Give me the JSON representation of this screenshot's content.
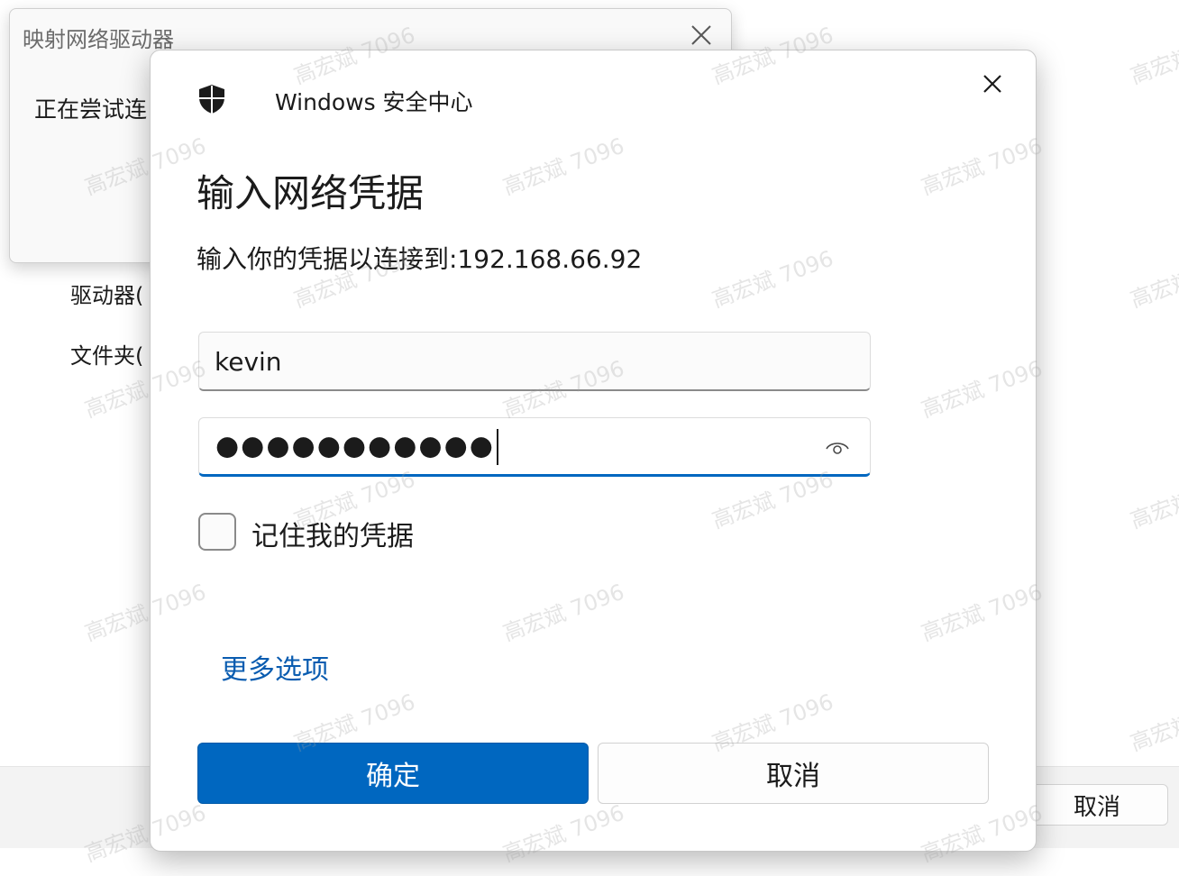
{
  "background": {
    "drive_label": "驱动器(",
    "folder_label": "文件夹(",
    "cancel_button": "取消"
  },
  "connecting_dialog": {
    "title": "映射网络驱动器",
    "status_text": "正在尝试连"
  },
  "security_dialog": {
    "app_title": "Windows 安全中心",
    "heading": "输入网络凭据",
    "subheading": "输入你的凭据以连接到:192.168.66.92",
    "username_value": "kevin",
    "password_mask": "●●●●●●●●●●●",
    "remember_label": "记住我的凭据",
    "more_options_link": "更多选项",
    "ok_button": "确定",
    "cancel_button": "取消"
  },
  "watermark_text": "高宏斌 7096",
  "colors": {
    "accent": "#0067c0",
    "link": "#0a5cb0"
  }
}
